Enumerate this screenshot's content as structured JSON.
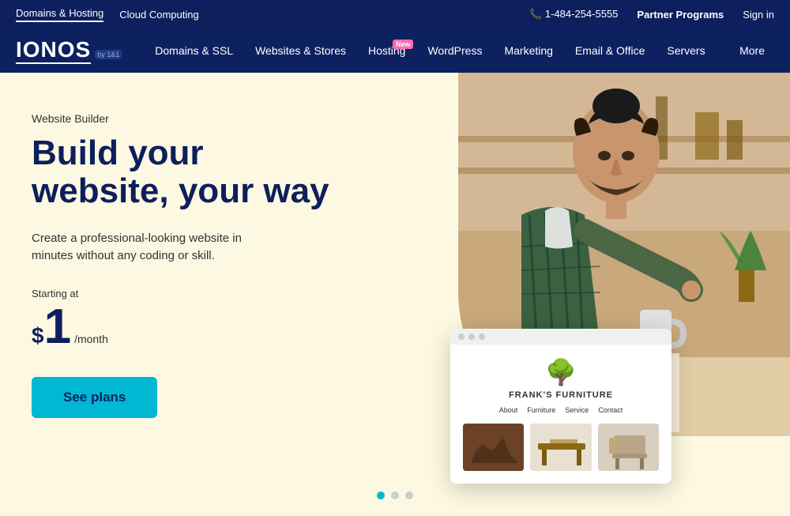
{
  "topBar": {
    "leftLinks": [
      {
        "label": "Domains & Hosting",
        "active": true
      },
      {
        "label": "Cloud Computing",
        "active": false
      }
    ],
    "phone": "1-484-254-5555",
    "rightLinks": [
      {
        "label": "Partner Programs"
      },
      {
        "label": "Sign in"
      }
    ]
  },
  "logo": {
    "text": "IONOS",
    "by": "by 1&1"
  },
  "mainNav": {
    "items": [
      {
        "label": "Domains & SSL",
        "badge": null
      },
      {
        "label": "Websites & Stores",
        "badge": null
      },
      {
        "label": "Hosting",
        "badge": "New"
      },
      {
        "label": "WordPress",
        "badge": null
      },
      {
        "label": "Marketing",
        "badge": null
      },
      {
        "label": "Email & Office",
        "badge": null
      },
      {
        "label": "Servers",
        "badge": null
      }
    ],
    "more": "More"
  },
  "hero": {
    "subtitle": "Website Builder",
    "title": "Build your website, your way",
    "description": "Create a professional-looking website in minutes without any coding or skill.",
    "startingAt": "Starting at",
    "dollarSign": "$",
    "price": "1",
    "perMonth": "/month",
    "ctaButton": "See plans"
  },
  "mockWebsite": {
    "storeName": "FRANK'S FURNITURE",
    "navItems": [
      "About",
      "Furniture",
      "Service",
      "Contact"
    ]
  },
  "colors": {
    "navBg": "#0d2161",
    "topBarBg": "#0d1f5c",
    "heroBg": "#fdf8e1",
    "ctaBg": "#00b8d4",
    "textDark": "#0d1f5c",
    "badgeBg": "#ff69b4"
  }
}
